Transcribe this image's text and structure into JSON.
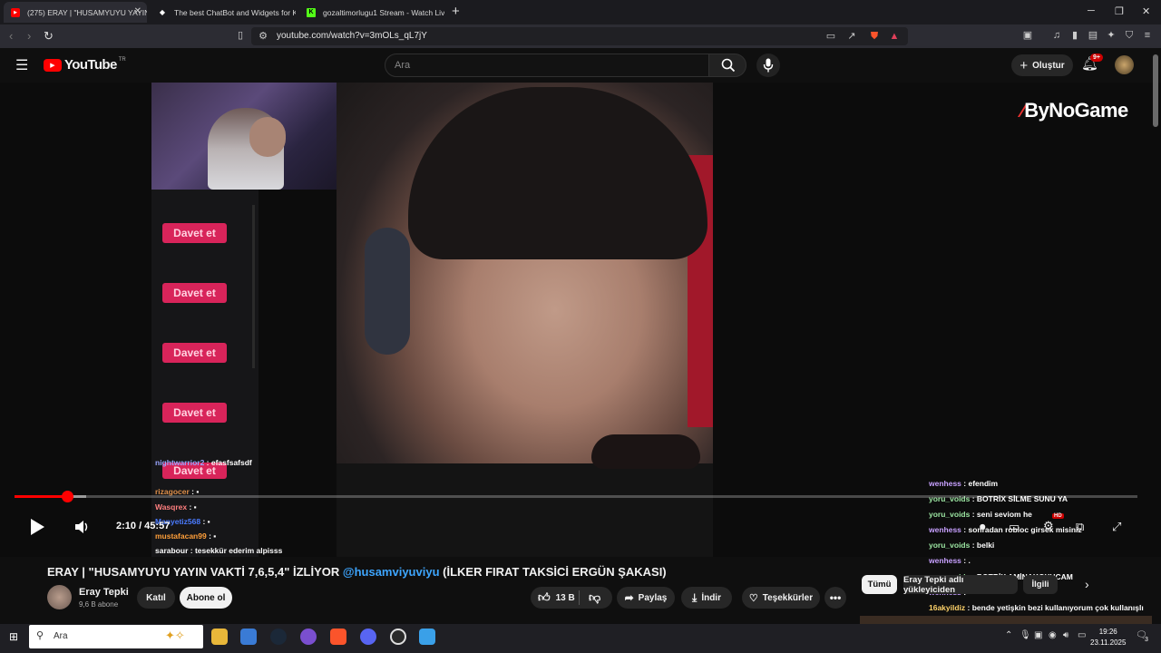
{
  "browser": {
    "tabs": [
      {
        "title": "(275) ERAY | \"HUSAMYUYU YAYIN",
        "active": true
      },
      {
        "title": "The best ChatBot and Widgets for Ki",
        "active": false
      },
      {
        "title": "gozaltimorlugu1 Stream - Watch Liv",
        "active": false
      }
    ],
    "url": "youtube.com/watch?v=3mOLs_qL7jY"
  },
  "youtube": {
    "logo_text": "YouTube",
    "logo_region": "TR",
    "search_placeholder": "Ara",
    "create_label": "Oluştur",
    "notification_count": "9+"
  },
  "video": {
    "davet_buttons": [
      "Davet et",
      "Davet et",
      "Davet et",
      "Davet et",
      "Davet et"
    ],
    "sponsor": "ByNoGame",
    "left_chat": [
      {
        "user": "nightwarrior2",
        "msg": "efasfsafsdf"
      },
      {
        "user": "rizagocer",
        "msg": ""
      },
      {
        "user": "Wasqrex",
        "msg": ""
      },
      {
        "user": "Manyetiz568",
        "msg": ""
      },
      {
        "user": "mustafacan99",
        "msg": ""
      },
      {
        "user": "sarabour",
        "msg": "tesekkür ederim alpisss"
      }
    ],
    "right_chat": [
      {
        "user": "wenhess",
        "msg": "efendim",
        "color": "p"
      },
      {
        "user": "yoru_voids",
        "msg": "BOTRİX SİLME SUNU YA",
        "color": "g"
      },
      {
        "user": "yoru_voids",
        "msg": "seni seviom he",
        "color": "g"
      },
      {
        "user": "wenhess",
        "msg": "sonradan robloc girsek misiniz",
        "color": "p"
      },
      {
        "user": "yoru_voids",
        "msg": "belki",
        "color": "g"
      },
      {
        "user": "wenhess",
        "msg": ".",
        "color": "p"
      },
      {
        "user": "yoru_voids",
        "msg": "BOTRİX AMİNAKOYUCAM",
        "color": "g"
      },
      {
        "user": "wenhess",
        "msg": "",
        "color": "p"
      },
      {
        "user": "16akyildiz",
        "msg": "bende yetişkin bezi kullanıyorum çok kullanışlı",
        "color": "y"
      }
    ],
    "time_current": "2:10",
    "time_total": "45:57",
    "time_display": "2:10 / 45:57",
    "progress_fraction": 0.047,
    "buffer_fraction": 0.064,
    "hd_badge": "HD"
  },
  "details": {
    "title_main": "ERAY | \"HUSAMYUYU YAYIN VAKTİ 7,6,5,4\" İZLİYOR ",
    "title_mention": "@husamviyuviyu",
    "title_rest": " (İLKER FIRAT TAKSİCİ ERGÜN ŞAKASI)",
    "channel": "Eray Tepki",
    "subscribers": "9,6 B abone",
    "join_label": "Katıl",
    "subscribe_label": "Abone ol",
    "likes": "13 B",
    "share_label": "Paylaş",
    "download_label": "İndir",
    "thanks_label": "Teşekkürler",
    "chips": [
      "Tümü",
      "Eray Tepki adlı yükleyiciden",
      "İlgili"
    ]
  },
  "taskbar": {
    "search_placeholder": "Ara",
    "time": "19:26",
    "date": "23.11.2025",
    "notif_count": "3"
  },
  "colors": {
    "yt_red": "#ff0000",
    "davet_pink": "#d8245a",
    "mention_blue": "#3ea6ff"
  }
}
